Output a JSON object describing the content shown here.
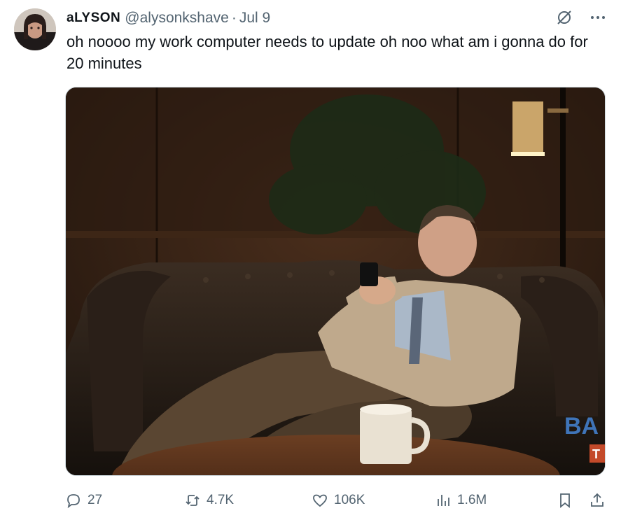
{
  "tweet": {
    "display_name": "aLYSON",
    "handle": "@alysonkshave",
    "separator": "·",
    "date": "Jul 9",
    "text": "oh noooo my work computer needs to update oh noo what am i gonna do for 20 minutes",
    "media": {
      "overlay_text": "BA",
      "overlay_text_small": "T"
    }
  },
  "header_icons": {
    "grok_icon": "grok-icon",
    "more_icon": "more-icon"
  },
  "actions": {
    "reply_count": "27",
    "repost_count": "4.7K",
    "like_count": "106K",
    "views_count": "1.6M"
  },
  "colors": {
    "secondary_text": "#536471",
    "primary_text": "#0f1419",
    "border": "#cfd9de"
  }
}
